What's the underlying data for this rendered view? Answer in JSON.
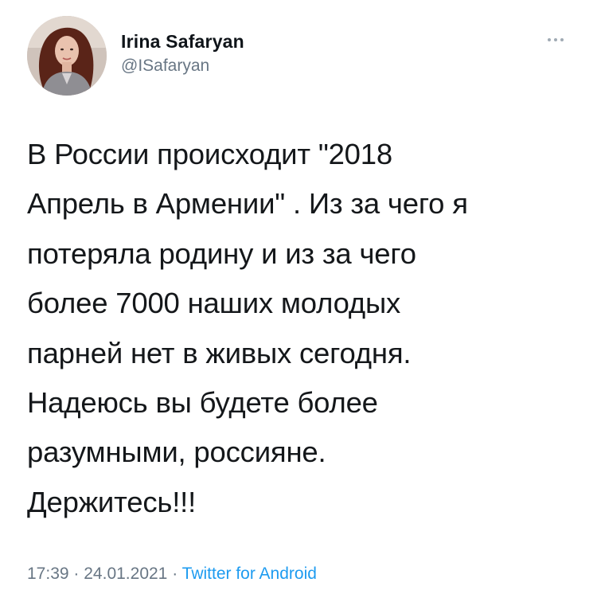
{
  "author": {
    "display_name": "Irina Safaryan",
    "handle": "@ISafaryan",
    "avatar_icon": "profile-photo"
  },
  "more_icon": "more-horizontal-icon",
  "tweet": {
    "text": "В России происходит \"2018\nАпрель в Армении\" . Из за чего я\nпотеряла родину и из за чего\nболее 7000 наших молодых\nпарней нет в живых сегодня.\nНадеюсь вы будете более\nразумными, россияне.\nДержитесь!!!"
  },
  "meta": {
    "time": "17:39",
    "separator": "·",
    "date": "24.01.2021",
    "source": "Twitter for Android"
  },
  "colors": {
    "text": "#14171a",
    "secondary": "#687684",
    "link": "#1d9bf0"
  }
}
